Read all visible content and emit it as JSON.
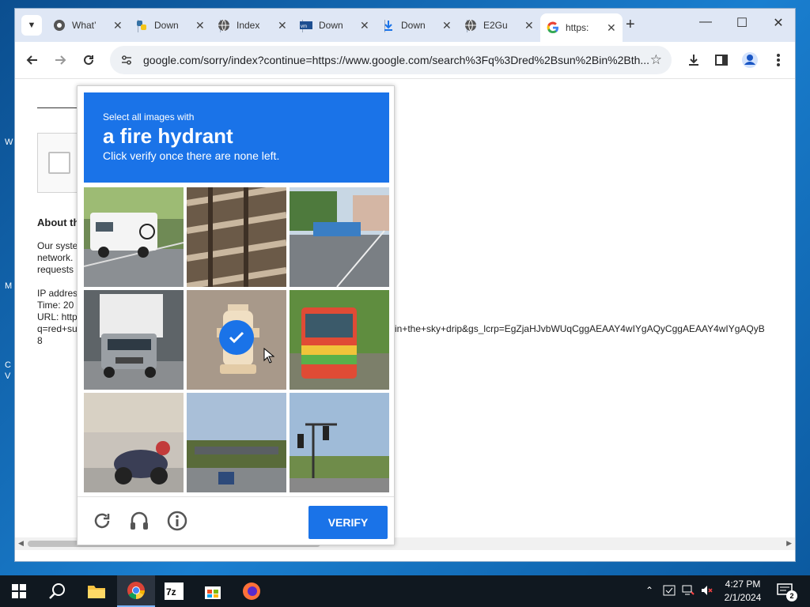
{
  "desktop": {
    "fragments": [
      "W",
      "M",
      "C",
      "V"
    ]
  },
  "browser": {
    "tabs": [
      {
        "label": "What’",
        "icon": "chrome-icon"
      },
      {
        "label": "Down",
        "icon": "python-icon"
      },
      {
        "label": "Index",
        "icon": "globe-icon"
      },
      {
        "label": "Down",
        "icon": "vmware-icon"
      },
      {
        "label": "Down",
        "icon": "download-icon"
      },
      {
        "label": "E2Gu",
        "icon": "globe-icon"
      },
      {
        "label": "https:",
        "icon": "google-icon"
      }
    ],
    "address": "google.com/sorry/index?continue=https://www.google.com/search%3Fq%3Dred%2Bsun%2Bin%2Bth..."
  },
  "page": {
    "about_heading": "About th",
    "paragraph_lines": [
      "Our syste",
      "network.",
      "requests"
    ],
    "ip_lines": [
      "IP addres",
      "Time: 20",
      "URL: http",
      "q=red+su",
      "8"
    ],
    "url_tail": "in+the+sky+drip&gs_lcrp=EgZjaHJvbWUqCggAEAAY4wIYgAQyCggAEAAY4wIYgAQyB"
  },
  "captcha": {
    "instruction_small": "Select all images with",
    "target": "a fire hydrant",
    "instruction_sub": "Click verify once there are none left.",
    "verify_label": "VERIFY",
    "tiles": [
      "RV on road",
      "building balconies",
      "buses on street",
      "truck in traffic",
      "fire hydrant (selected)",
      "bus",
      "motorcycle",
      "overpass highway",
      "traffic lights"
    ]
  },
  "taskbar": {
    "time": "4:27 PM",
    "date": "2/1/2024",
    "notifications": "2"
  }
}
